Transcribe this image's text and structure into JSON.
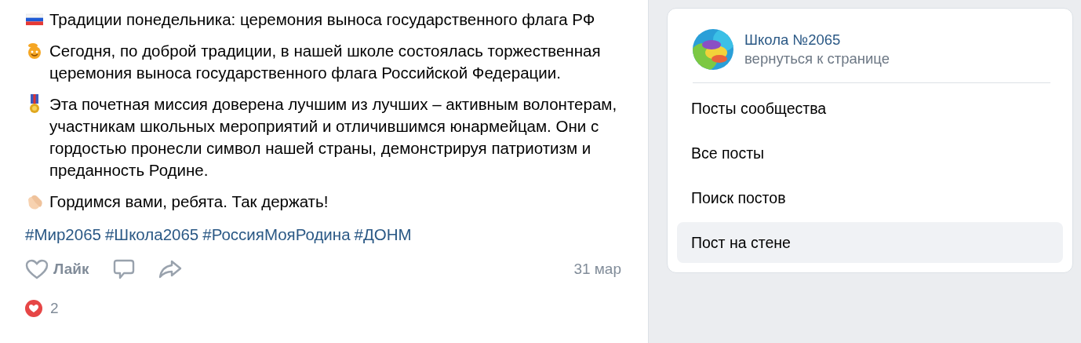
{
  "post": {
    "paragraphs": [
      {
        "kind": "flag",
        "text": "Традиции понедельника: церемония выноса государственного флага РФ"
      },
      {
        "kind": "smiley",
        "text": "Сегодня, по доброй традиции, в нашей школе состоялась торжественная церемония выноса государственного флага Российской Федерации."
      },
      {
        "kind": "medal",
        "text": "Эта почетная миссия доверена лучшим из лучших – активным волонтерам, участникам школьных мероприятий и отличившимся юнармейцам. Они с гордостью пронесли символ нашей страны, демонстрируя патриотизм и преданность Родине."
      },
      {
        "kind": "clap",
        "text": "Гордимся вами, ребята. Так держать!"
      }
    ],
    "hashtags": [
      "#Мир2065",
      "#Школа2065",
      "#РоссияМояРодина",
      "#ДОНМ"
    ],
    "like": {
      "label": "Лайк",
      "liked": false
    },
    "date": "31 мар",
    "reactions": {
      "count": "2"
    }
  },
  "sidebar": {
    "group": {
      "name": "Школа №2065",
      "subtitle": "вернуться к странице"
    },
    "items": [
      {
        "label": "Посты сообщества",
        "selected": false
      },
      {
        "label": "Все посты",
        "selected": false
      },
      {
        "label": "Поиск постов",
        "selected": false
      },
      {
        "label": "Пост на стене",
        "selected": true
      }
    ]
  }
}
